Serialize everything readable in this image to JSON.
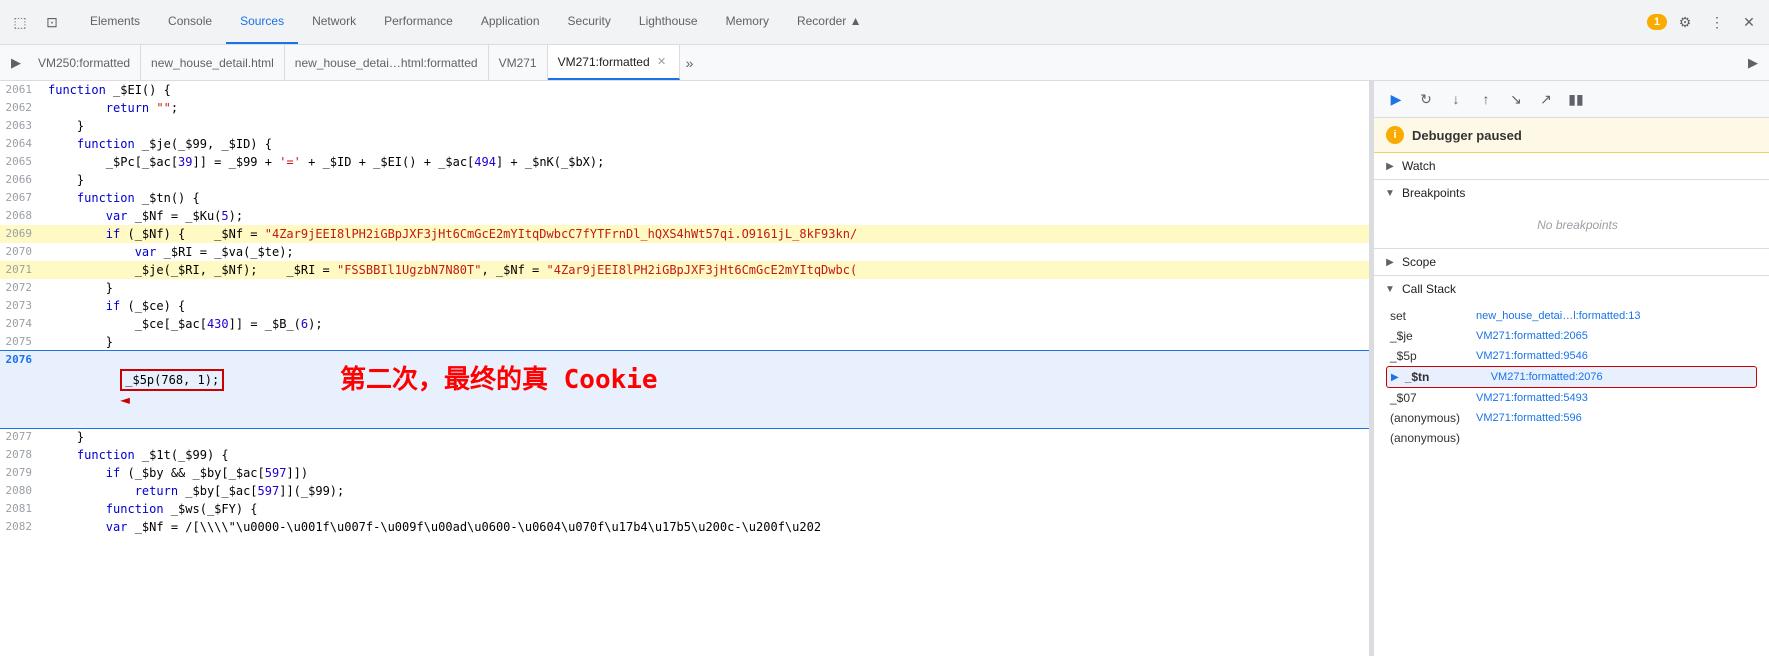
{
  "tabs": {
    "items": [
      {
        "label": "Elements",
        "active": false
      },
      {
        "label": "Console",
        "active": false
      },
      {
        "label": "Sources",
        "active": true
      },
      {
        "label": "Network",
        "active": false
      },
      {
        "label": "Performance",
        "active": false
      },
      {
        "label": "Application",
        "active": false
      },
      {
        "label": "Security",
        "active": false
      },
      {
        "label": "Lighthouse",
        "active": false
      },
      {
        "label": "Memory",
        "active": false
      },
      {
        "label": "Recorder ▲",
        "active": false
      }
    ]
  },
  "file_tabs": [
    {
      "label": "VM250:formatted",
      "active": false,
      "closable": false
    },
    {
      "label": "new_house_detail.html",
      "active": false,
      "closable": false
    },
    {
      "label": "new_house_detai…html:formatted",
      "active": false,
      "closable": false
    },
    {
      "label": "VM271",
      "active": false,
      "closable": false
    },
    {
      "label": "VM271:formatted",
      "active": true,
      "closable": true
    }
  ],
  "code_lines": [
    {
      "num": "2061",
      "code": "    function _$EI() {",
      "type": "normal"
    },
    {
      "num": "2062",
      "code": "        return \"\";",
      "type": "normal"
    },
    {
      "num": "2063",
      "code": "    }",
      "type": "normal"
    },
    {
      "num": "2064",
      "code": "    function _$je(_$99, _$ID) {",
      "type": "normal"
    },
    {
      "num": "2065",
      "code": "        _$Pc[_$ac[39]] = _$99 + '=' + _$ID + _$EI() + _$ac[494] + _$nK(_$bX);",
      "type": "normal"
    },
    {
      "num": "2066",
      "code": "    }",
      "type": "normal"
    },
    {
      "num": "2067",
      "code": "    function _$tn() {",
      "type": "normal"
    },
    {
      "num": "2068",
      "code": "        var _$Nf = _$Ku(5);",
      "type": "normal"
    },
    {
      "num": "2069",
      "code": "        if (_$Nf) {    _$Nf = \"4Zar9jEEI8lPH2iGBpJXF3jHt6CmGcE2mYItqDwbcC7fYTFrnDl_hQXS4hWt57qi.O9161jL_8kF93kn/",
      "type": "highlighted"
    },
    {
      "num": "2070",
      "code": "            var _$RI = _$va(_$te);",
      "type": "normal"
    },
    {
      "num": "2071",
      "code": "            _$je(_$RI, _$Nf);    _$RI = \"FSSBBIl1UgzbN7N80T\", _$Nf = \"4Zar9jEEI8lPH2iGBpJXF3jHt6CmGcE2mYItqDwbc(",
      "type": "highlighted"
    },
    {
      "num": "2072",
      "code": "        }",
      "type": "normal"
    },
    {
      "num": "2073",
      "code": "        if (_$ce) {",
      "type": "normal"
    },
    {
      "num": "2074",
      "code": "            _$ce[_$ac[430]] = _$B_(6);",
      "type": "normal"
    },
    {
      "num": "2075",
      "code": "        }",
      "type": "normal"
    },
    {
      "num": "2076",
      "code": "        _$5p(768, 1);",
      "type": "current",
      "boxed": true
    },
    {
      "num": "2077",
      "code": "    }",
      "type": "normal"
    },
    {
      "num": "2078",
      "code": "    function _$1t(_$99) {",
      "type": "normal"
    },
    {
      "num": "2079",
      "code": "        if (_$by && _$by[_$ac[597]])",
      "type": "normal"
    },
    {
      "num": "2080",
      "code": "            return _$by[_$ac[597]](_$99);",
      "type": "normal"
    },
    {
      "num": "2081",
      "code": "        function _$ws(_$FY) {",
      "type": "normal"
    },
    {
      "num": "2082",
      "code": "        var _$Nf = /[\\\\\"\\u0000-\\u001f\\u007f-\\u009f\\u00ad\\u0600-\\u0604\\u070f\\u17b4\\u17b5\\u200c-\\u200f\\u202",
      "type": "normal"
    }
  ],
  "right_panel": {
    "debugger_paused": "Debugger paused",
    "sections": {
      "watch": {
        "label": "Watch",
        "expanded": false
      },
      "breakpoints": {
        "label": "Breakpoints",
        "expanded": true,
        "empty_text": "No breakpoints"
      },
      "scope": {
        "label": "Scope",
        "expanded": false
      },
      "call_stack": {
        "label": "Call Stack",
        "expanded": true,
        "items": [
          {
            "fn": "set",
            "loc": "new_house_detai…l:formatted:13",
            "active": false,
            "has_play": false
          },
          {
            "fn": "_$je",
            "loc": "VM271:formatted:2065",
            "active": false,
            "has_play": false
          },
          {
            "fn": "_$5p",
            "loc": "VM271:formatted:9546",
            "active": false,
            "has_play": false
          },
          {
            "fn": "_$tn",
            "loc": "VM271:formatted:2076",
            "active": true,
            "has_play": true
          },
          {
            "fn": "_$07",
            "loc": "VM271:formatted:5493",
            "active": false,
            "has_play": false
          },
          {
            "fn": "(anonymous)",
            "loc": "VM271:formatted:596",
            "active": false,
            "has_play": false
          },
          {
            "fn": "(anonymous)",
            "loc": "",
            "active": false,
            "has_play": false
          }
        ]
      }
    }
  },
  "annotation": {
    "text": "第二次，最终的真 Cookie",
    "color": "#ff0000"
  },
  "toolbar": {
    "icons": [
      "☰",
      "⬜"
    ],
    "right_icons": [
      "⚙",
      "⋮",
      "✕"
    ]
  },
  "debug_controls": [
    "▶",
    "↺",
    "⬇",
    "↑",
    "↘",
    "↗",
    "⏸"
  ],
  "badge_count": "1"
}
